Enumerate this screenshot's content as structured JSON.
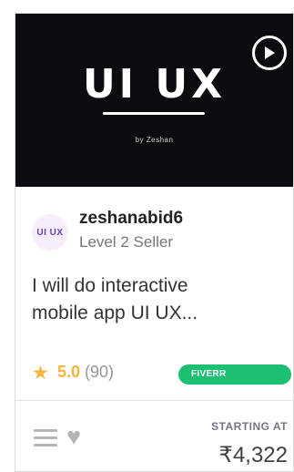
{
  "thumbnail": {
    "title": "UI UX",
    "subtitle": "by Zeshan"
  },
  "seller": {
    "avatar_text": "UI UX",
    "name": "zeshanabid6",
    "level": "Level 2 Seller"
  },
  "gig": {
    "title_line1": "I will do interactive",
    "title_line2": "mobile app UI UX..."
  },
  "rating": {
    "value": "5.0",
    "count": "(90)"
  },
  "badge": {
    "label": "FIVERR CERTIFIED",
    "color": "#1dbf73"
  },
  "pricing": {
    "label": "STARTING AT",
    "price": "₹4,322"
  },
  "colors": {
    "star": "#ffb33e",
    "thumbnail_bg": "#0b0b10"
  }
}
